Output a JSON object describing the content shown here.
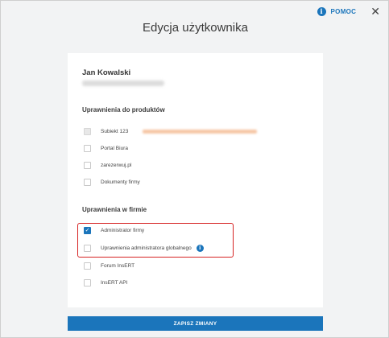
{
  "header": {
    "help_label": "POMOC",
    "help_icon": "i",
    "close_icon": "✕"
  },
  "title": "Edycja użytkownika",
  "user": {
    "name": "Jan Kowalski"
  },
  "products": {
    "title": "Uprawnienia do produktów",
    "items": [
      {
        "label": "Subiekt 123",
        "state": "disabled"
      },
      {
        "label": "Portal Biura",
        "state": "unchecked"
      },
      {
        "label": "zarezerwuj.pl",
        "state": "unchecked"
      },
      {
        "label": "Dokumenty firmy",
        "state": "unchecked"
      }
    ]
  },
  "company": {
    "title": "Uprawnienia w firmie",
    "items": [
      {
        "label": "Administrator firmy",
        "state": "checked",
        "mark": "✓"
      },
      {
        "label": "Uprawnienia administratora globalnego",
        "state": "unchecked",
        "info_icon": "i"
      },
      {
        "label": "Forum InsERT",
        "state": "unchecked"
      },
      {
        "label": "InsERT API",
        "state": "unchecked"
      }
    ]
  },
  "save_label": "ZAPISZ ZMIANY",
  "colors": {
    "accent": "#1b75bb",
    "highlight": "#d62222",
    "background": "#f2f3f4"
  }
}
